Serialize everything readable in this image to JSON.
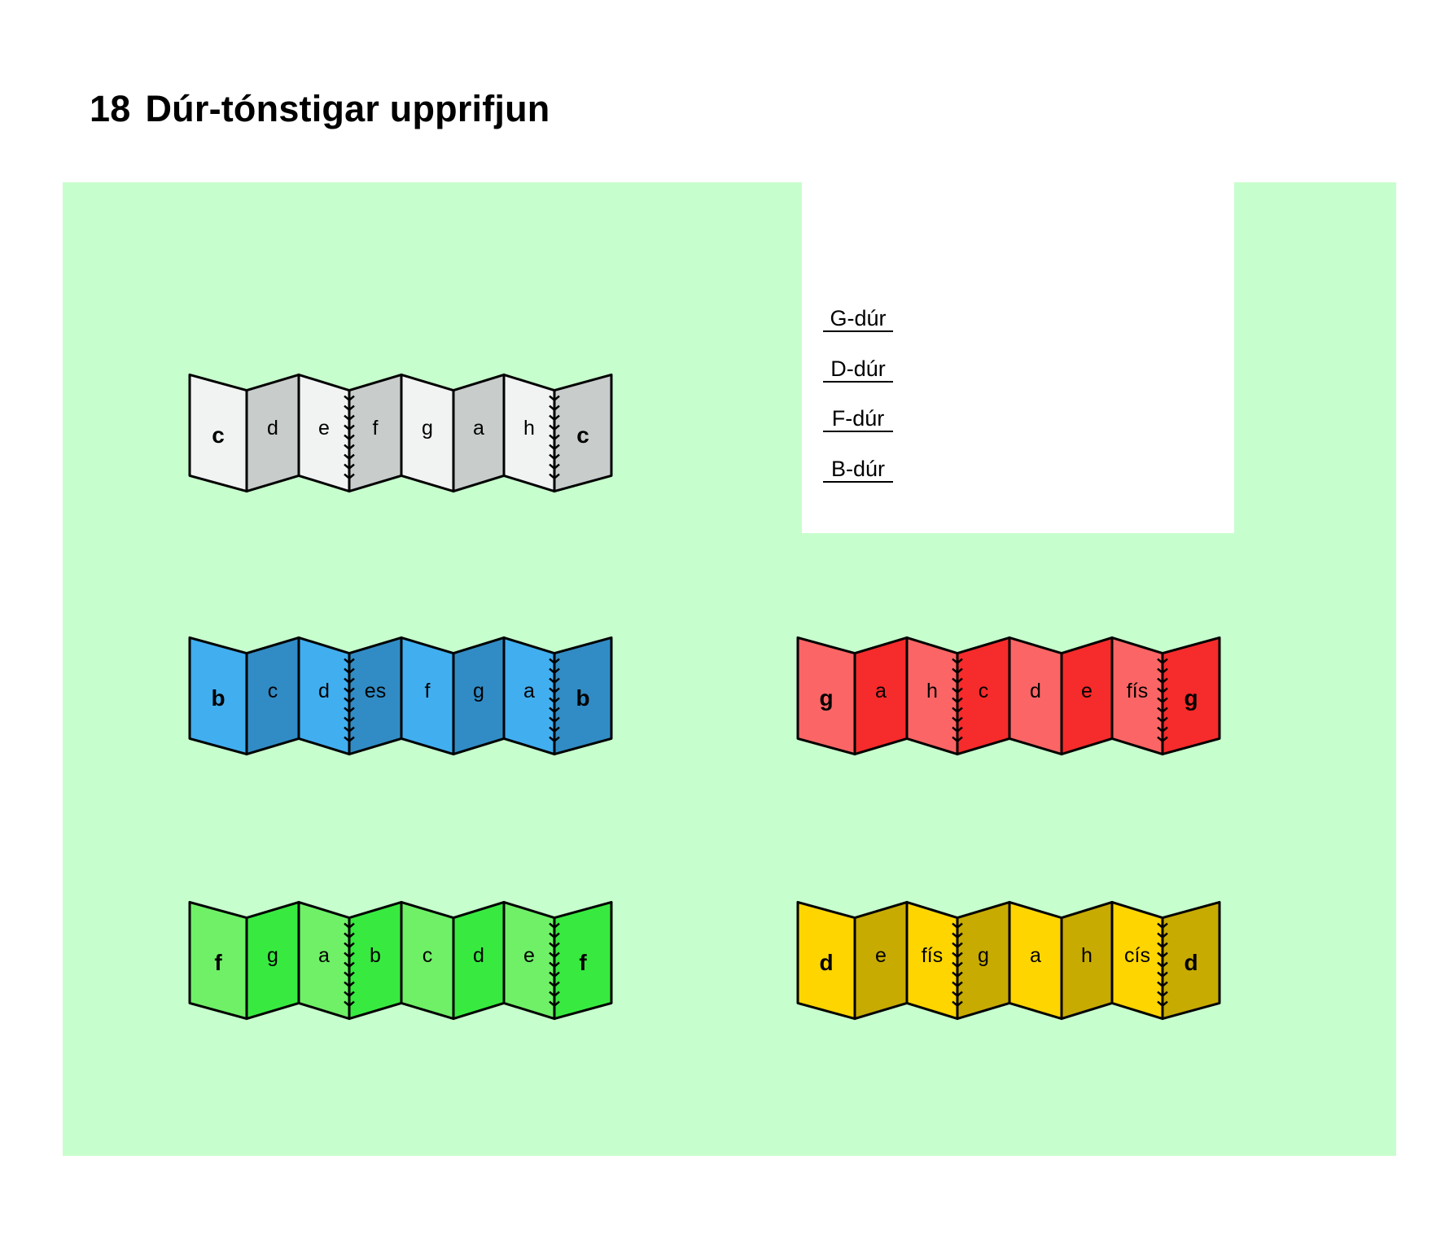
{
  "page": {
    "number": "18",
    "title": "Dúr-tónstigar upprifjun"
  },
  "key": {
    "items": [
      "G-dúr",
      "D-dúr",
      "F-dúr",
      "B-dúr"
    ]
  },
  "scales": [
    {
      "name": "c-scale",
      "notes": [
        "c",
        "d",
        "e",
        "f",
        "g",
        "a",
        "h",
        "c"
      ],
      "colors": {
        "light": "#f1f2f2",
        "dark": "#c8cdcc"
      }
    },
    {
      "name": "b-scale",
      "notes": [
        "b",
        "c",
        "d",
        "es",
        "f",
        "g",
        "a",
        "b"
      ],
      "colors": {
        "light": "#41aeef",
        "dark": "#318cc5"
      }
    },
    {
      "name": "g-scale",
      "notes": [
        "g",
        "a",
        "h",
        "c",
        "d",
        "e",
        "fís",
        "g"
      ],
      "colors": {
        "light": "#fc6565",
        "dark": "#f62b2b"
      }
    },
    {
      "name": "f-scale",
      "notes": [
        "f",
        "g",
        "a",
        "b",
        "c",
        "d",
        "e",
        "f"
      ],
      "colors": {
        "light": "#6ff067",
        "dark": "#38ea40"
      }
    },
    {
      "name": "d-scale",
      "notes": [
        "d",
        "e",
        "fís",
        "g",
        "a",
        "h",
        "cís",
        "d"
      ],
      "colors": {
        "light": "#ffd500",
        "dark": "#c8ab00"
      }
    }
  ],
  "colors": {
    "panel": "#c7fecd",
    "ink": "#000000"
  }
}
